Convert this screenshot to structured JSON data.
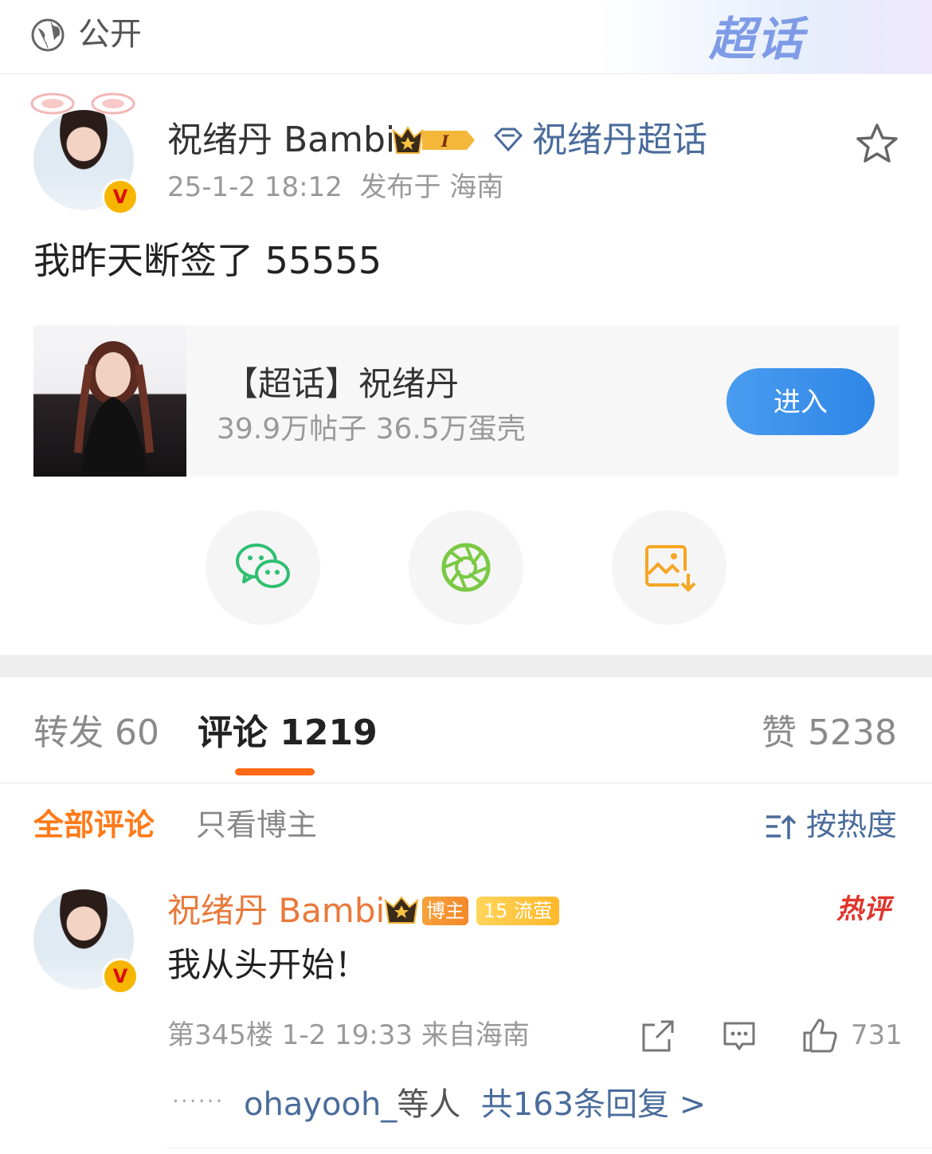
{
  "topbar": {
    "visibility": "公开",
    "supertopic_logo": "超话"
  },
  "post": {
    "author": "祝绪丹 Bambi",
    "supertopic_link": "祝绪丹超话",
    "time": "25-1-2 18:12",
    "location": "发布于 海南",
    "text": "我昨天断签了 55555",
    "card": {
      "title": "【超话】祝绪丹",
      "stats": "39.9万帖子 36.5万蛋壳",
      "button": "进入"
    },
    "share": [
      "wechat-icon",
      "moments-icon",
      "save-image-icon"
    ]
  },
  "tabs": {
    "repost": "转发 60",
    "comment": "评论 1219",
    "like": "赞 5238"
  },
  "filters": {
    "all": "全部评论",
    "host_only": "只看博主",
    "sort": "按热度"
  },
  "comment": {
    "author": "祝绪丹 Bambi",
    "tag_host": "博主",
    "tag_fan_level": "15",
    "tag_fan_name": "流萤",
    "hot_badge": "热评",
    "text": "我从头开始！",
    "meta": "第345楼 1-2 19:33 来自海南",
    "likes": "731",
    "reply_users": "ohayooh_",
    "reply_mid": "等人",
    "reply_more": "共163条回复 >"
  },
  "colors": {
    "accent": "#ff6a16",
    "link": "#4a6c9b",
    "enter_button": "#2f86e6"
  }
}
